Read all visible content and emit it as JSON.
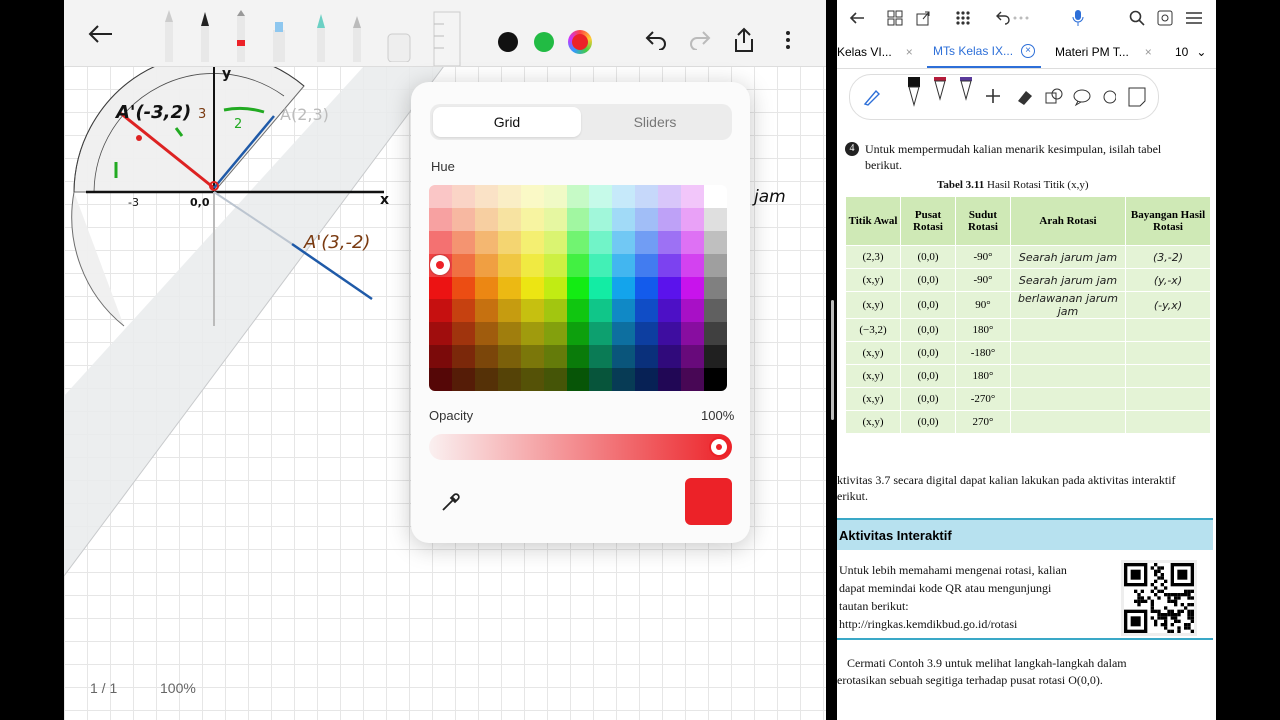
{
  "left": {
    "toolbar": {
      "back_icon": "arrow-left-icon",
      "pens": [
        "pencil",
        "ink-pen",
        "fineliner",
        "highlighter",
        "marker",
        "brush",
        "eraser",
        "ruler"
      ],
      "colors": [
        "#111111",
        "#22bb44",
        "#ec2228"
      ],
      "undo_icon": "undo-icon",
      "redo_icon": "redo-icon",
      "share_icon": "share-icon",
      "more_icon": "more-vertical-icon"
    },
    "canvas": {
      "notes": {
        "a1": "A'(-3,2)",
        "a2": "A(2,3)",
        "a3": "A'(3,-2)",
        "jam": "jam",
        "origin": "0,0",
        "neg3": "-3",
        "n3": "3",
        "n2": "2",
        "x": "x",
        "y": "y"
      }
    },
    "footer": {
      "page": "1 / 1",
      "zoom": "100%"
    }
  },
  "popup": {
    "tabs": {
      "grid": "Grid",
      "sliders": "Sliders"
    },
    "hue_label": "Hue",
    "opacity_label": "Opacity",
    "opacity_value": "100%",
    "opacity_level": 1.0,
    "selected_color": "#ec2228",
    "eyedropper_icon": "eyedropper-icon"
  },
  "right": {
    "topbar_icons": [
      "back",
      "forward",
      "grid",
      "share",
      "apps",
      "undo",
      "mic",
      "search",
      "settings",
      "menu"
    ],
    "tabs": [
      {
        "label": "Kelas VI..."
      },
      {
        "label": "MTs Kelas IX..."
      },
      {
        "label": "Materi PM T..."
      }
    ],
    "tab_count": "10",
    "question_number": "4",
    "question_text_1": "Untuk mempermudah kalian menarik kesimpulan, isilah tabel",
    "question_text_2": "berikut.",
    "table_caption_bold": "Tabel 3.11",
    "table_caption": " Hasil Rotasi Titik (x,y)",
    "table_headers": [
      "Titik Awal",
      "Pusat Rotasi",
      "Sudut Rotasi",
      "Arah Rotasi",
      "Bayangan Hasil Rotasi"
    ],
    "table_rows": [
      {
        "titik": "(2,3)",
        "pusat": "(0,0)",
        "sudut": "-90°",
        "arah": "Searah jarum jam",
        "bayangan": "(3,-2)"
      },
      {
        "titik": "(x,y)",
        "pusat": "(0,0)",
        "sudut": "-90°",
        "arah": "Searah jarum jam",
        "bayangan": "(y,-x)"
      },
      {
        "titik": "(x,y)",
        "pusat": "(0,0)",
        "sudut": "90°",
        "arah": "berlawanan jarum jam",
        "bayangan": "(-y,x)"
      },
      {
        "titik": "(−3,2)",
        "pusat": "(0,0)",
        "sudut": "180°",
        "arah": "",
        "bayangan": ""
      },
      {
        "titik": "(x,y)",
        "pusat": "(0,0)",
        "sudut": "-180°",
        "arah": "",
        "bayangan": ""
      },
      {
        "titik": "(x,y)",
        "pusat": "(0,0)",
        "sudut": "180°",
        "arah": "",
        "bayangan": ""
      },
      {
        "titik": "(x,y)",
        "pusat": "(0,0)",
        "sudut": "-270°",
        "arah": "",
        "bayangan": ""
      },
      {
        "titik": "(x,y)",
        "pusat": "(0,0)",
        "sudut": "270°",
        "arah": "",
        "bayangan": ""
      }
    ],
    "para1_line1": "ktivitas 3.7 secara digital dapat kalian lakukan pada aktivitas interaktif",
    "para1_line2": "erikut.",
    "activity_title": "Aktivitas Interaktif",
    "activity_text_1": "Untuk lebih memahami mengenai rotasi, kalian",
    "activity_text_2": "dapat memindai kode QR atau mengunjungi",
    "activity_text_3": "tautan berikut:",
    "activity_link": "http://ringkas.kemdikbud.go.id/rotasi",
    "para2_line1": "Cermati Contoh 3.9 untuk melihat langkah-langkah dalam",
    "para2_line2": "erotasikan sebuah segitiga terhadap pusat rotasi O(0,0).",
    "accent_colors": {
      "table_header": "#cfe9b6",
      "table_row": "#e4f3d6",
      "activity": "#b7e1ef"
    }
  }
}
